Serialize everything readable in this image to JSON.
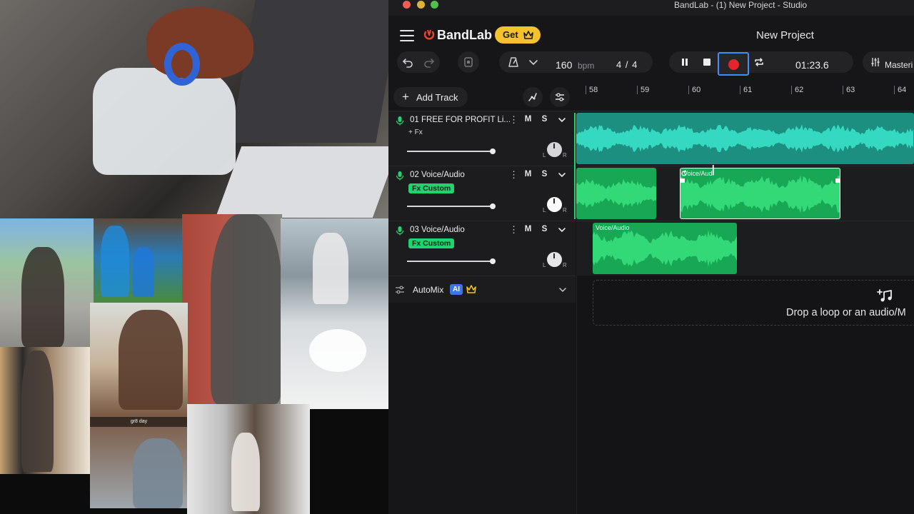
{
  "window": {
    "title": "BandLab - (1) New Project - Studio"
  },
  "collage": {
    "caption": "gr8 day"
  },
  "header": {
    "logo_text": "BandLab",
    "get_label": "Get",
    "project_name": "New Project"
  },
  "toolbar": {
    "bpm_value": "160",
    "bpm_unit": "bpm",
    "time_signature": "4 / 4",
    "time_display": "01:23.6",
    "mastering_label": "Masteri"
  },
  "tracklist": {
    "add_track_label": "Add Track",
    "tracks": [
      {
        "name": "01  FREE FOR PROFIT Li...",
        "fx": "+ Fx",
        "volume": 0.75
      },
      {
        "name": "02  Voice/Audio",
        "fx": "Fx Custom",
        "volume": 0.75
      },
      {
        "name": "03  Voice/Audio",
        "fx": "Fx Custom",
        "volume": 0.75
      }
    ],
    "mute_label": "M",
    "solo_label": "S",
    "pan_left": "L",
    "pan_right": "R",
    "automix_label": "AutoMix",
    "ai_badge": "AI"
  },
  "timeline": {
    "bars": [
      "58",
      "59",
      "60",
      "61",
      "62",
      "63",
      "64"
    ],
    "regions": {
      "track2_b_label": "Voice/Audi",
      "track3_label": "Voice/Audio"
    },
    "drop_text": "Drop a loop or an audio/M"
  },
  "colors": {
    "accent_green": "#1fd36e",
    "teal_track": "#27c2a8",
    "record_red": "#e5252a",
    "get_yellow": "#f3c22c",
    "record_focus": "#3f8dff"
  }
}
